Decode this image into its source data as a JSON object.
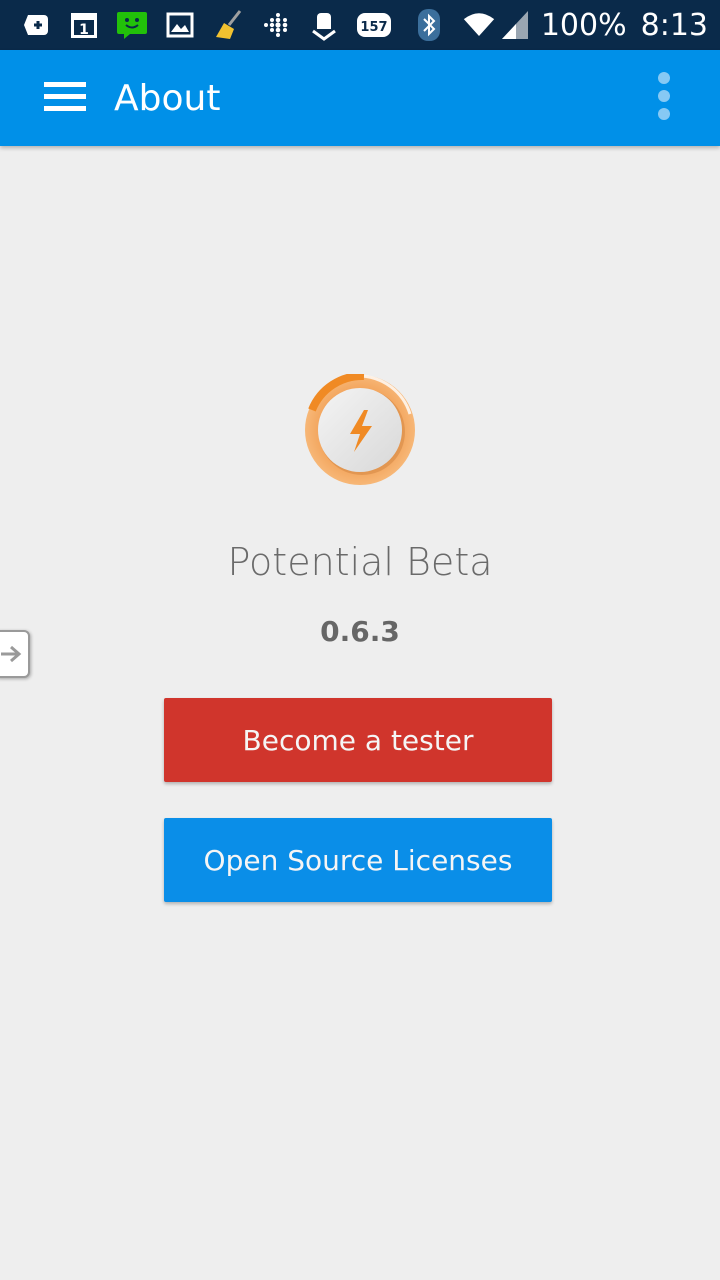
{
  "status_bar": {
    "battery": "100%",
    "time": "8:13",
    "badge_count": "157",
    "calendar_day": "1",
    "icons": [
      "add-box-icon",
      "calendar-icon",
      "message-icon",
      "gallery-icon",
      "cleaner-icon",
      "fitbit-icon",
      "android-download-icon",
      "badge-icon",
      "bluetooth-icon",
      "wifi-icon",
      "signal-icon"
    ]
  },
  "app_bar": {
    "title": "About",
    "color": "#0090e8"
  },
  "content": {
    "app_name": "Potential Beta",
    "version": "0.6.3"
  },
  "buttons": {
    "tester_label": "Become a tester",
    "tester_color": "#d0352c",
    "licenses_label": "Open Source Licenses",
    "licenses_color": "#0a8ee8"
  },
  "colors": {
    "background": "#eeeeee",
    "logo_accent": "#f08a24"
  }
}
